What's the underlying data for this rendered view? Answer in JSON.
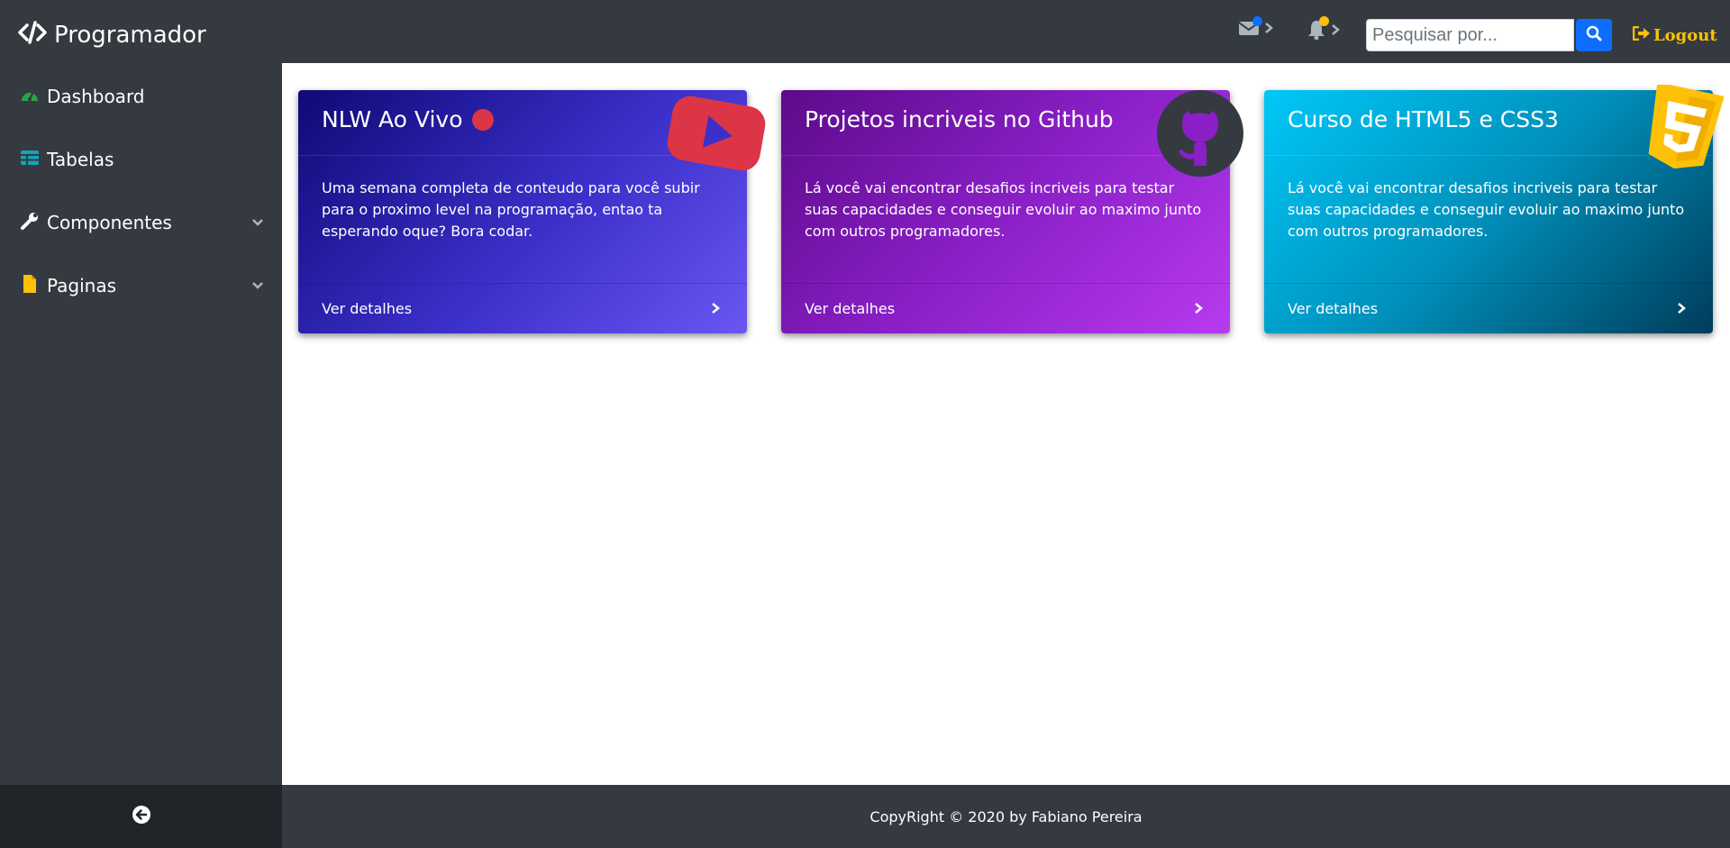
{
  "brand": {
    "name": "Programador",
    "icon": "code-icon"
  },
  "topbar": {
    "messages_icon": "envelope-icon",
    "notifications_icon": "bell-icon",
    "search": {
      "placeholder": "Pesquisar por...",
      "value": ""
    },
    "logout_label": "Logout",
    "colors": {
      "message_badge": "#0d6efd",
      "notification_badge": "#ffc107",
      "logout": "#ffc107"
    }
  },
  "sidebar": {
    "items": [
      {
        "label": "Dashboard",
        "icon": "tachometer-icon",
        "icon_color": "#28a745",
        "has_submenu": false
      },
      {
        "label": "Tabelas",
        "icon": "table-icon",
        "icon_color": "#17a2b8",
        "has_submenu": false
      },
      {
        "label": "Componentes",
        "icon": "wrench-icon",
        "icon_color": "#ffffff",
        "has_submenu": true
      },
      {
        "label": "Paginas",
        "icon": "file-icon",
        "icon_color": "#ffc107",
        "has_submenu": true
      }
    ],
    "toggle_icon": "arrow-circle-left-icon"
  },
  "cards": [
    {
      "title": "NLW Ao Vivo",
      "text": "Uma semana completa de conteudo para você subir para o proximo level na programação, entao ta esperando oque? Bora codar.",
      "footer_label": "Ver detalhes",
      "logo": "youtube-icon",
      "live_dot_color": "#dc3545"
    },
    {
      "title": "Projetos incriveis no Github",
      "text": "Lá você vai encontrar desafios incriveis para testar suas capacidades e conseguir evoluir ao maximo junto com outros programadores.",
      "footer_label": "Ver detalhes",
      "logo": "github-icon"
    },
    {
      "title": "Curso de HTML5 e CSS3",
      "text": "Lá você vai encontrar desafios incriveis para testar suas capacidades e conseguir evoluir ao maximo junto com outros programadores.",
      "footer_label": "Ver detalhes",
      "logo": "html5-icon"
    }
  ],
  "footer": {
    "copyright": "CopyRight © 2020 by Fabiano Pereira"
  }
}
